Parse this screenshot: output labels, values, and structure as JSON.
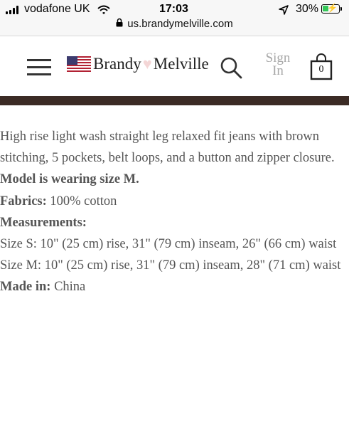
{
  "status_bar": {
    "carrier": "vodafone UK",
    "time": "17:03",
    "battery_percent": "30%",
    "battery_color": "#34c759"
  },
  "browser": {
    "url": "us.brandymelville.com"
  },
  "header": {
    "brand_left": "Brandy",
    "brand_right": "Melville",
    "sign_in_line1": "Sign",
    "sign_in_line2": "In",
    "cart_count": "0",
    "band_color": "#3b2b25"
  },
  "product": {
    "description": "High rise light wash straight leg relaxed fit jeans with brown stitching, 5 pockets, belt loops, and a button and zipper closure.",
    "model_note": "Model is wearing size M.",
    "fabrics_label": "Fabrics:",
    "fabrics_value": "100% cotton",
    "measurements_label": "Measurements:",
    "size_s": "Size S: 10\" (25 cm) rise, 31\" (79 cm) inseam, 26\" (66 cm) waist",
    "size_m": "Size M: 10\" (25 cm) rise, 31\" (79 cm) inseam, 28\" (71 cm) waist",
    "made_in_label": "Made in:",
    "made_in_value": "China"
  }
}
